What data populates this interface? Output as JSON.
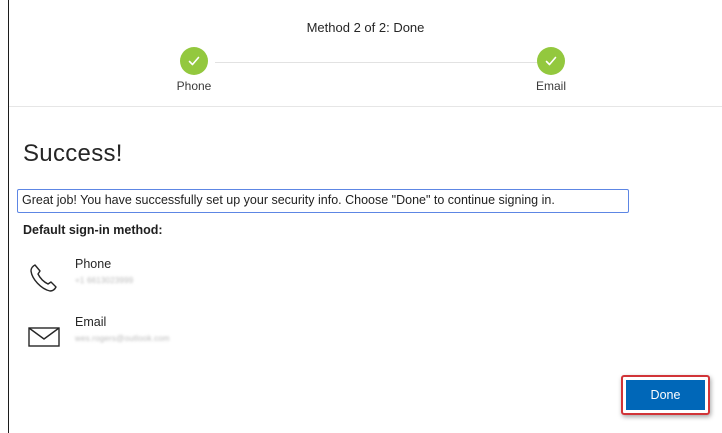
{
  "header": {
    "title": "Method 2 of 2: Done",
    "steps": [
      {
        "label": "Phone",
        "status": "complete"
      },
      {
        "label": "Email",
        "status": "complete"
      }
    ]
  },
  "main": {
    "title": "Success!",
    "message": "Great job! You have successfully set up your security info. Choose \"Done\" to continue signing in.",
    "default_label": "Default sign-in method:",
    "methods": [
      {
        "name": "Phone",
        "detail": "+1 6613023999",
        "icon": "phone-icon"
      },
      {
        "name": "Email",
        "detail": "wes.rogers@outlook.com",
        "icon": "envelope-icon"
      }
    ]
  },
  "actions": {
    "done_label": "Done"
  },
  "colors": {
    "step_complete": "#93c83e",
    "primary_button": "#0067b8",
    "highlight_border": "#d13438",
    "message_border": "#5d86e4"
  }
}
